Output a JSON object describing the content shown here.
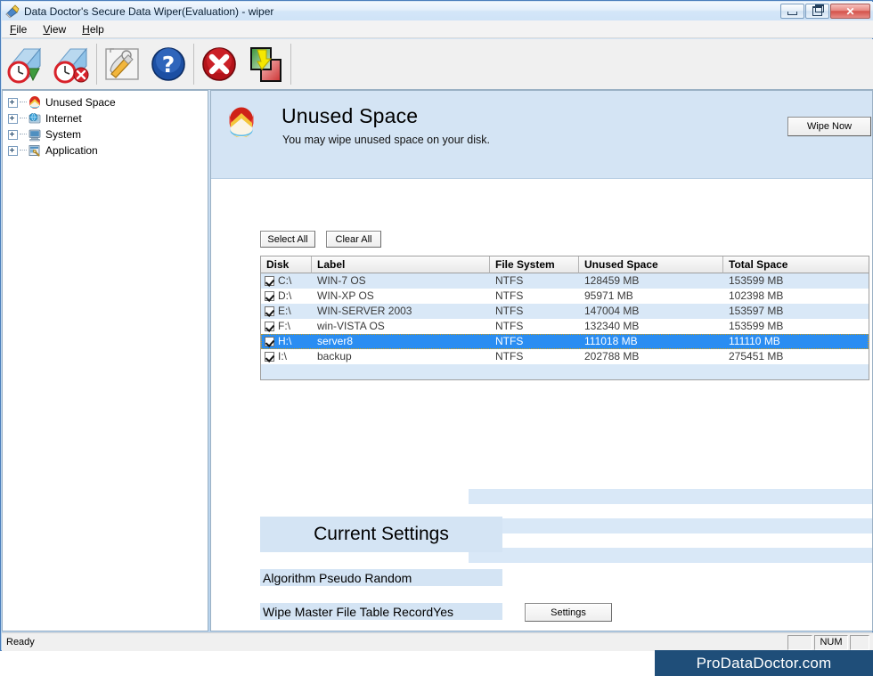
{
  "window": {
    "title": "Data Doctor's Secure Data Wiper(Evaluation) - wiper",
    "app_icon": "wiper-app-icon",
    "controls": {
      "minimize": "minimize-button",
      "restore": "restore-button",
      "close_glyph": "✕"
    }
  },
  "menubar": {
    "items": [
      {
        "accel": "F",
        "rest": "ile"
      },
      {
        "accel": "V",
        "rest": "iew"
      },
      {
        "accel": "H",
        "rest": "elp"
      }
    ]
  },
  "toolbar": {
    "buttons": [
      {
        "name": "wipe-schedule-icon",
        "tooltip": "Schedule Wipe"
      },
      {
        "name": "remove-schedule-icon",
        "tooltip": "Remove Schedule"
      },
      {
        "name": "settings-tools-icon",
        "tooltip": "Settings"
      },
      {
        "name": "help-icon",
        "tooltip": "Help"
      },
      {
        "name": "stop-icon",
        "tooltip": "Stop"
      },
      {
        "name": "wipe-now-icon",
        "tooltip": "Wipe Now"
      }
    ]
  },
  "sidebar": {
    "items": [
      {
        "label": "Unused Space",
        "icon": "disk-pie-icon"
      },
      {
        "label": "Internet",
        "icon": "globe-monitor-icon"
      },
      {
        "label": "System",
        "icon": "computer-icon"
      },
      {
        "label": "Application",
        "icon": "application-icon"
      }
    ]
  },
  "header": {
    "icon": "disk-pie-icon",
    "title": "Unused Space",
    "subtitle": "You may wipe unused space on your disk.",
    "wipe_now_label": "Wipe Now"
  },
  "actions": {
    "select_all": "Select All",
    "clear_all": "Clear All"
  },
  "table": {
    "columns": [
      "Disk",
      "Label",
      "File System",
      "Unused Space",
      "Total Space"
    ],
    "rows": [
      {
        "checked": true,
        "disk": "C:\\",
        "label": "WIN-7 OS",
        "fs": "NTFS",
        "unused": "128459 MB",
        "total": "153599 MB",
        "selected": false
      },
      {
        "checked": true,
        "disk": "D:\\",
        "label": "WIN-XP OS",
        "fs": "NTFS",
        "unused": "95971 MB",
        "total": "102398 MB",
        "selected": false
      },
      {
        "checked": true,
        "disk": "E:\\",
        "label": "WIN-SERVER 2003",
        "fs": "NTFS",
        "unused": "147004 MB",
        "total": "153597 MB",
        "selected": false
      },
      {
        "checked": true,
        "disk": "F:\\",
        "label": "win-VISTA OS",
        "fs": "NTFS",
        "unused": "132340 MB",
        "total": "153599 MB",
        "selected": false
      },
      {
        "checked": true,
        "disk": "H:\\",
        "label": "server8",
        "fs": "NTFS",
        "unused": "111018 MB",
        "total": "111110 MB",
        "selected": true
      },
      {
        "checked": true,
        "disk": "I:\\",
        "label": "backup",
        "fs": "NTFS",
        "unused": "202788 MB",
        "total": "275451 MB",
        "selected": false
      }
    ],
    "empty_row_count": 1,
    "filler_stripe_tops": [
      447,
      480,
      513
    ]
  },
  "current_settings": {
    "title": "Current Settings",
    "algorithm_line": "Algorithm Pseudo Random",
    "mft_line": "Wipe Master File Table RecordYes",
    "settings_button": "Settings"
  },
  "statusbar": {
    "text": "Ready",
    "num_indicator": "NUM"
  },
  "branding": {
    "text": "ProDataDoctor.com",
    "background": "#1f4e79"
  },
  "colors": {
    "header_band": "#d4e4f4",
    "row_stripe": "#d9e8f7",
    "selection": "#2a8df2",
    "window_frame": "#4a7ebb"
  }
}
